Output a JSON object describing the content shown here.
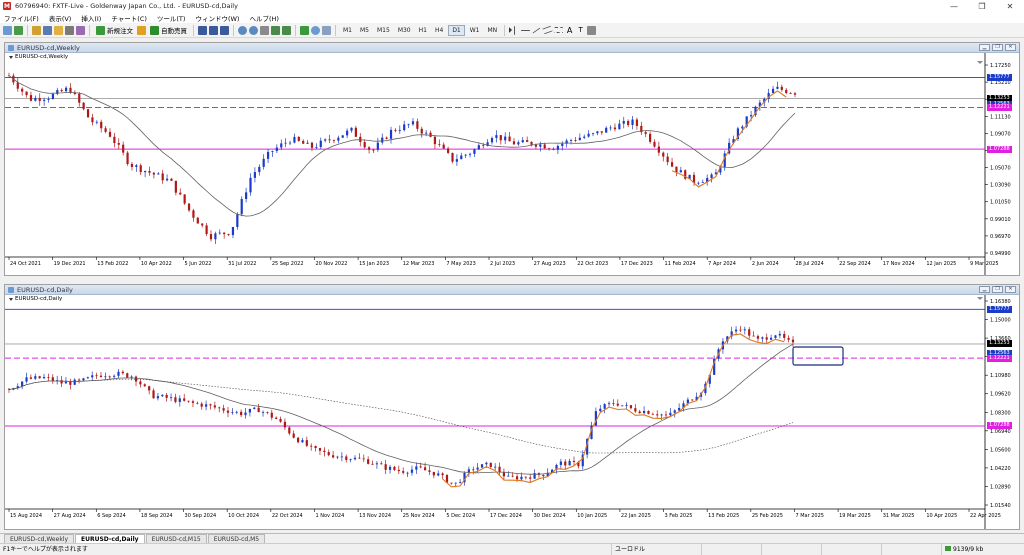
{
  "window": {
    "title": "60796940: FXTF-Live - Goldenway Japan Co., Ltd. - EURUSD-cd,Daily",
    "controls": [
      "—",
      "❐",
      "✕"
    ]
  },
  "menu": [
    "ファイル(F)",
    "表示(V)",
    "挿入(I)",
    "チャート(C)",
    "ツール(T)",
    "ウィンドウ(W)",
    "ヘルプ(H)"
  ],
  "toolbar": {
    "new_order": "新規注文",
    "auto_trade": "自動売買",
    "timeframes": [
      "M1",
      "M5",
      "M15",
      "M30",
      "H1",
      "H4",
      "D1",
      "W1",
      "MN"
    ],
    "active_timeframe": "D1"
  },
  "charts": {
    "weekly": {
      "window_title": "EURUSD-cd,Weekly",
      "symbol_label": "EURUSD-cd,Weekly",
      "price_ticks": [
        "1.17250",
        "1.15210",
        "1.13170",
        "1.11130",
        "1.09070",
        "1.07020",
        "1.05070",
        "1.03090",
        "1.01050",
        "0.99010",
        "0.96970",
        "0.94990"
      ],
      "tags": [
        {
          "text": "1.15777",
          "color": "#1a3cc8",
          "price": 1.15777
        },
        {
          "text": "1.13253",
          "color": "#000000",
          "price": 1.13253
        },
        {
          "text": "1.12563",
          "color": "#1a3cc8",
          "price": 1.12563
        },
        {
          "text": "1.12221",
          "color": "#e020e0",
          "price": 1.12221
        },
        {
          "text": "1.07288",
          "color": "#e020e0",
          "price": 1.07288
        }
      ],
      "date_ticks": [
        "24 Oct 2021",
        "19 Dec 2021",
        "13 Feb 2022",
        "10 Apr 2022",
        "5 Jun 2022",
        "31 Jul 2022",
        "25 Sep 2022",
        "20 Nov 2022",
        "15 Jan 2023",
        "12 Mar 2023",
        "7 May 2023",
        "2 Jul 2023",
        "27 Aug 2023",
        "22 Oct 2023",
        "17 Dec 2023",
        "11 Feb 2024",
        "7 Apr 2024",
        "2 Jun 2024",
        "28 Jul 2024",
        "22 Sep 2024",
        "17 Nov 2024",
        "12 Jan 2025",
        "9 Mar 2025"
      ]
    },
    "daily": {
      "window_title": "EURUSD-cd,Daily",
      "symbol_label": "EURUSD-cd,Daily",
      "price_ticks": [
        "1.16380",
        "1.15000",
        "1.13660",
        "1.12310",
        "1.10980",
        "1.09620",
        "1.08300",
        "1.06940",
        "1.05600",
        "1.04220",
        "1.02890",
        "1.01540"
      ],
      "tags": [
        {
          "text": "1.15777",
          "color": "#1a3cc8",
          "price": 1.15777
        },
        {
          "text": "1.13253",
          "color": "#000000",
          "price": 1.13253
        },
        {
          "text": "1.12563",
          "color": "#1a3cc8",
          "price": 1.12563
        },
        {
          "text": "1.12221",
          "color": "#e020e0",
          "price": 1.12221
        },
        {
          "text": "1.07288",
          "color": "#e020e0",
          "price": 1.07288
        }
      ],
      "date_ticks": [
        "15 Aug 2024",
        "27 Aug 2024",
        "6 Sep 2024",
        "18 Sep 2024",
        "30 Sep 2024",
        "10 Oct 2024",
        "22 Oct 2024",
        "1 Nov 2024",
        "13 Nov 2024",
        "25 Nov 2024",
        "5 Dec 2024",
        "17 Dec 2024",
        "30 Dec 2024",
        "10 Jan 2025",
        "22 Jan 2025",
        "3 Feb 2025",
        "13 Feb 2025",
        "25 Feb 2025",
        "7 Mar 2025",
        "19 Mar 2025",
        "31 Mar 2025",
        "10 Apr 2025",
        "22 Apr 2025"
      ]
    }
  },
  "tabs": [
    "EURUSD-cd,Weekly",
    "EURUSD-cd,Daily",
    "EURUSD-cd,M15",
    "EURUSD-cd,M5"
  ],
  "active_tab": "EURUSD-cd,Daily",
  "status": {
    "help": "F1キーでヘルプが表示されます",
    "profile": "ユーロドル",
    "traffic": "9139/9 kb"
  },
  "colors": {
    "bull": "#1a3cc8",
    "bear": "#b01818",
    "ma": "#606060",
    "magenta_line": "#e020e0",
    "resist_line": "#1a3cc8",
    "swing": "#e07820",
    "highlight_box": "#1a2f80"
  },
  "chart_data": [
    {
      "type": "candlestick",
      "title": "EURUSD-cd,Weekly",
      "ylim": [
        0.9499,
        1.1725
      ],
      "horizontal_lines": [
        1.15777,
        1.13253,
        1.12221,
        1.07288
      ],
      "series": [
        {
          "name": "close_path",
          "values": [
            1.16,
            1.132,
            1.135,
            1.145,
            1.108,
            1.09,
            1.055,
            1.045,
            1.035,
            0.998,
            0.97,
            0.975,
            1.04,
            1.07,
            1.085,
            1.075,
            1.085,
            1.095,
            1.07,
            1.095,
            1.103,
            1.085,
            1.06,
            1.07,
            1.09,
            1.08,
            1.08,
            1.075,
            1.085,
            1.09,
            1.1,
            1.105,
            1.08,
            1.05,
            1.035,
            1.04,
            1.09,
            1.12,
            1.145,
            1.14
          ]
        }
      ]
    },
    {
      "type": "candlestick",
      "title": "EURUSD-cd,Daily",
      "ylim": [
        1.0154,
        1.1638
      ],
      "horizontal_lines": [
        1.15777,
        1.13253,
        1.12221,
        1.07288
      ],
      "series": [
        {
          "name": "close_path",
          "values": [
            1.1,
            1.107,
            1.108,
            1.104,
            1.105,
            1.11,
            1.111,
            1.109,
            1.095,
            1.093,
            1.09,
            1.088,
            1.085,
            1.082,
            1.085,
            1.078,
            1.065,
            1.056,
            1.052,
            1.05,
            1.048,
            1.043,
            1.04,
            1.042,
            1.038,
            1.03,
            1.042,
            1.045,
            1.035,
            1.036,
            1.038,
            1.046,
            1.045,
            1.085,
            1.09,
            1.085,
            1.083,
            1.08,
            1.09,
            1.1,
            1.135,
            1.145,
            1.135,
            1.14,
            1.132
          ]
        }
      ]
    }
  ]
}
